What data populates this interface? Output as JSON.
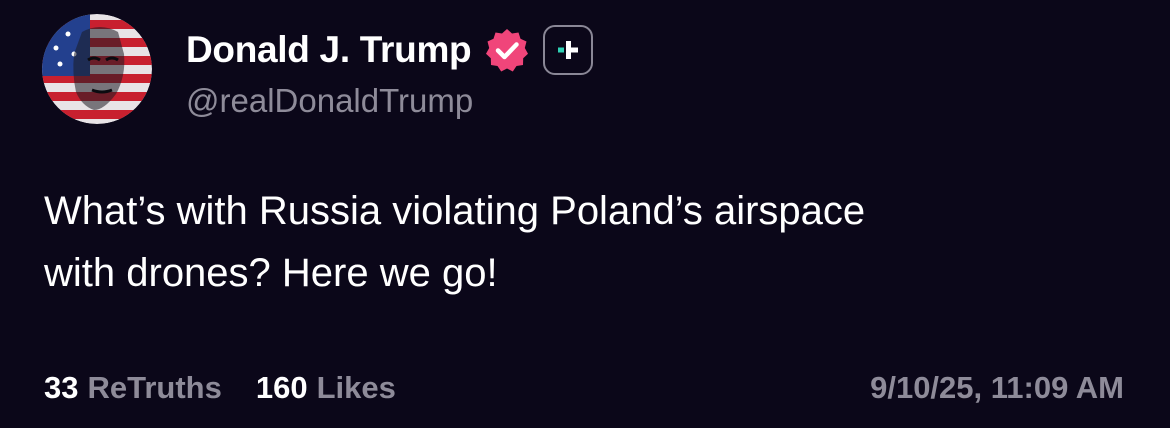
{
  "post": {
    "author": {
      "display_name": "Donald J. Trump",
      "handle": "@realDonaldTrump",
      "verified_icon": "verified-badge-icon",
      "follow_icon": "plus-icon"
    },
    "body_lines": [
      "What’s with Russia violating Poland’s airspace",
      "with drones? Here we go!"
    ],
    "stats": {
      "retruths_count": "33",
      "retruths_label": "ReTruths",
      "likes_count": "160",
      "likes_label": "Likes"
    },
    "timestamp": "9/10/25, 11:09 AM"
  },
  "colors": {
    "background": "#0b0719",
    "text_primary": "#ffffff",
    "text_secondary": "#8e8b99",
    "verified_badge": "#f0457a",
    "follow_accent": "#2fd0b4"
  }
}
